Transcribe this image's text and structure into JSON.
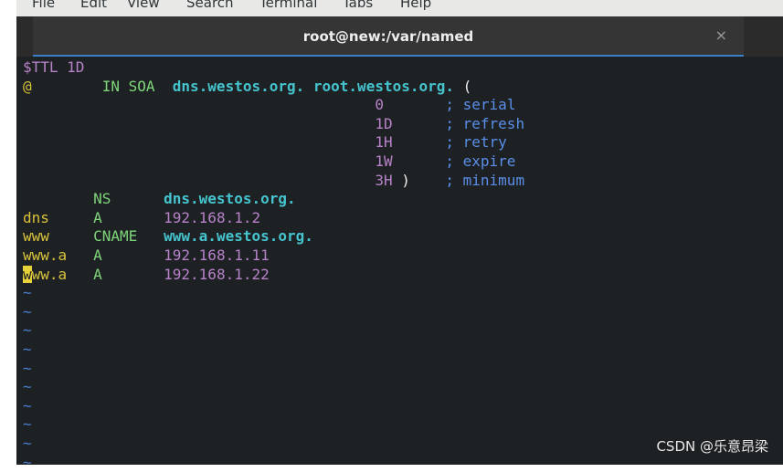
{
  "menubar": {
    "items": [
      "File",
      "Edit",
      "View",
      "Search",
      "Terminal",
      "Tabs",
      "Help"
    ]
  },
  "tab": {
    "title": "root@new:/var/named",
    "close": "×"
  },
  "terminal": {
    "lines": [
      [
        {
          "t": "$TTL 1D",
          "c": "purple"
        }
      ],
      [
        {
          "t": "@",
          "c": "yellow"
        },
        {
          "t": "        IN SOA  ",
          "c": "green"
        },
        {
          "t": "dns.westos.org. root.westos.org.",
          "c": "cyan"
        },
        {
          "t": " (",
          "c": "white"
        }
      ],
      [
        {
          "t": "                                        0",
          "c": "purple"
        },
        {
          "t": "       ; serial",
          "c": "blue"
        }
      ],
      [
        {
          "t": "                                        1D",
          "c": "purple"
        },
        {
          "t": "      ; refresh",
          "c": "blue"
        }
      ],
      [
        {
          "t": "                                        1H",
          "c": "purple"
        },
        {
          "t": "      ; retry",
          "c": "blue"
        }
      ],
      [
        {
          "t": "                                        1W",
          "c": "purple"
        },
        {
          "t": "      ; expire",
          "c": "blue"
        }
      ],
      [
        {
          "t": "                                        3H",
          "c": "purple"
        },
        {
          "t": " )",
          "c": "white"
        },
        {
          "t": "    ; minimum",
          "c": "blue"
        }
      ],
      [
        {
          "t": "        NS      ",
          "c": "green"
        },
        {
          "t": "dns.westos.org.",
          "c": "cyan"
        }
      ],
      [
        {
          "t": "dns",
          "c": "yellow"
        },
        {
          "t": "     A       ",
          "c": "green"
        },
        {
          "t": "192.168.1.2",
          "c": "purple"
        }
      ],
      [
        {
          "t": "www",
          "c": "yellow"
        },
        {
          "t": "     CNAME   ",
          "c": "green"
        },
        {
          "t": "www.a.westos.org.",
          "c": "cyan"
        }
      ],
      [
        {
          "t": "www.a",
          "c": "yellow"
        },
        {
          "t": "   A       ",
          "c": "green"
        },
        {
          "t": "192.168.1.11",
          "c": "purple"
        }
      ],
      [
        {
          "t": "w",
          "c": "cursor"
        },
        {
          "t": "ww.a",
          "c": "yellow"
        },
        {
          "t": "   A       ",
          "c": "green"
        },
        {
          "t": "192.168.1.22",
          "c": "purple"
        }
      ]
    ],
    "tilde": "~",
    "tilde_count": 10
  },
  "watermark": "CSDN @乐意昂梁"
}
